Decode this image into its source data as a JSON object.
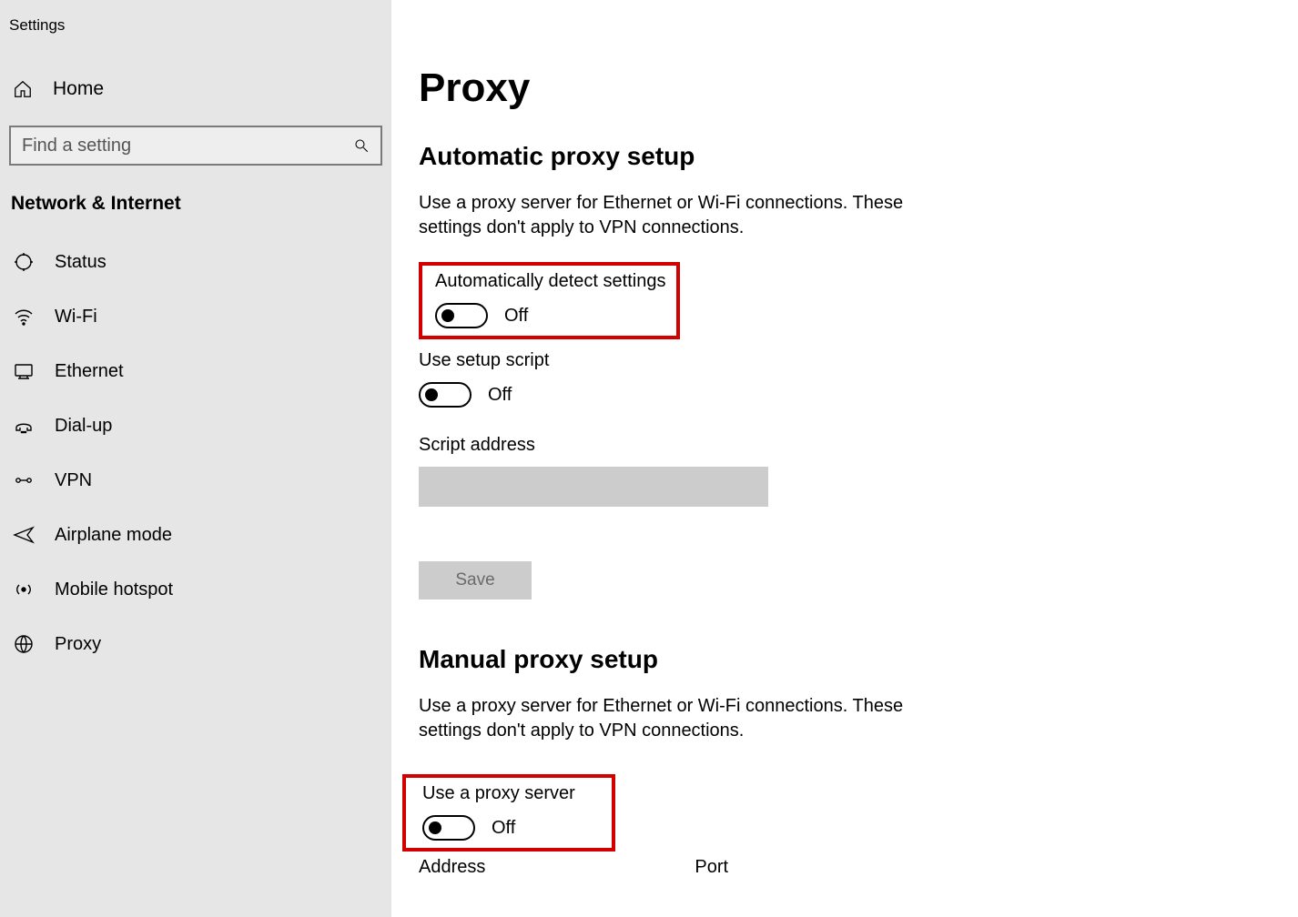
{
  "window_title": "Settings",
  "sidebar": {
    "home_label": "Home",
    "search_placeholder": "Find a setting",
    "category_title": "Network & Internet",
    "items": [
      {
        "label": "Status",
        "icon": "status-icon"
      },
      {
        "label": "Wi-Fi",
        "icon": "wifi-icon"
      },
      {
        "label": "Ethernet",
        "icon": "ethernet-icon"
      },
      {
        "label": "Dial-up",
        "icon": "dialup-icon"
      },
      {
        "label": "VPN",
        "icon": "vpn-icon"
      },
      {
        "label": "Airplane mode",
        "icon": "airplane-icon"
      },
      {
        "label": "Mobile hotspot",
        "icon": "hotspot-icon"
      },
      {
        "label": "Proxy",
        "icon": "globe-icon"
      }
    ]
  },
  "main": {
    "page_title": "Proxy",
    "auto": {
      "section_title": "Automatic proxy setup",
      "description": "Use a proxy server for Ethernet or Wi-Fi connections. These settings don't apply to VPN connections.",
      "auto_detect_label": "Automatically detect settings",
      "auto_detect_state": "Off",
      "use_script_label": "Use setup script",
      "use_script_state": "Off",
      "script_address_label": "Script address",
      "script_address_value": "",
      "save_label": "Save"
    },
    "manual": {
      "section_title": "Manual proxy setup",
      "description": "Use a proxy server for Ethernet or Wi-Fi connections. These settings don't apply to VPN connections.",
      "use_proxy_label": "Use a proxy server",
      "use_proxy_state": "Off",
      "address_label": "Address",
      "port_label": "Port"
    }
  }
}
